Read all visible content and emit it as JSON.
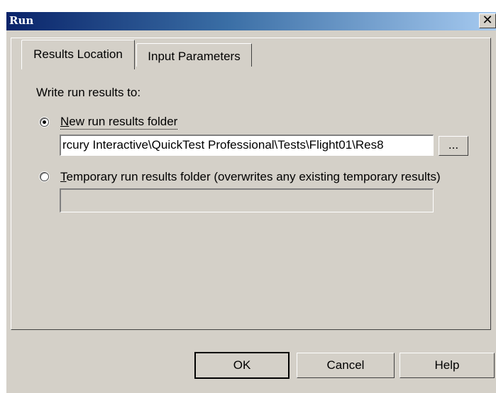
{
  "dialog": {
    "title": "Run",
    "close_glyph": "✕"
  },
  "tabs": [
    {
      "label": "Results Location",
      "active": true
    },
    {
      "label": "Input Parameters",
      "active": false
    }
  ],
  "section_label": "Write run results to:",
  "options": {
    "new_folder": {
      "label_access": "N",
      "label_rest": "ew run results folder",
      "selected": true,
      "path_value": "rcury Interactive\\QuickTest Professional\\Tests\\Flight01\\Res8",
      "browse_label": "..."
    },
    "temp_folder": {
      "label_access": "T",
      "label_rest": "emporary run results folder (overwrites any existing temporary results)",
      "selected": false,
      "path_value": ""
    }
  },
  "buttons": {
    "ok": "OK",
    "cancel": "Cancel",
    "help": "Help"
  }
}
